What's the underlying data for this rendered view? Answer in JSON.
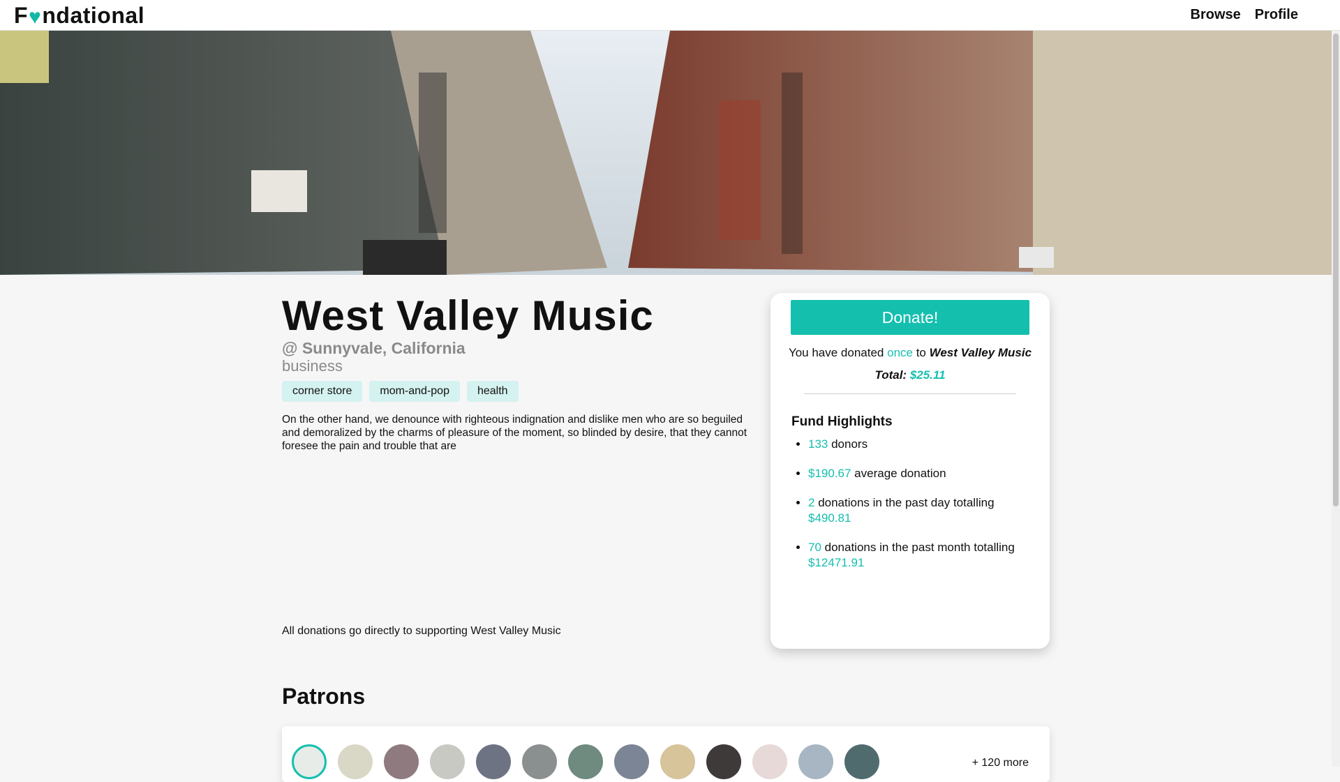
{
  "header": {
    "logo_left": "F",
    "logo_right": "ndational",
    "nav": [
      {
        "label": "Browse"
      },
      {
        "label": "Profile"
      }
    ]
  },
  "business": {
    "name": "West Valley Music",
    "location": "@ Sunnyvale, California",
    "category": "business",
    "tags": [
      "corner store",
      "mom-and-pop",
      "health"
    ],
    "description": "On the other hand, we denounce with righteous indignation and dislike men who are so beguiled and demoralized by the charms of pleasure of the moment, so blinded by desire, that they cannot foresee the pain and trouble that are",
    "footnote": "All donations go directly to supporting West Valley Music"
  },
  "donation_card": {
    "donate_label": "Donate!",
    "donated_prefix": "You have donated ",
    "donated_count": "once",
    "donated_mid": " to ",
    "donated_business": "West Valley Music",
    "total_label": "Total: ",
    "total_value": "$25.11",
    "highlights_title": "Fund Highlights",
    "highlights": [
      {
        "value": "133",
        "text": " donors",
        "value2": ""
      },
      {
        "value": "$190.67",
        "text": " average donation",
        "value2": ""
      },
      {
        "value": "2",
        "text": " donations in the past day totalling",
        "value2": "$490.81"
      },
      {
        "value": "70",
        "text": " donations in the past month totalling",
        "value2": "$12471.91"
      }
    ]
  },
  "patrons": {
    "title": "Patrons",
    "more": "+ 120 more"
  },
  "colors": {
    "accent": "#14bfae",
    "tag_bg": "#d4f2ef"
  }
}
